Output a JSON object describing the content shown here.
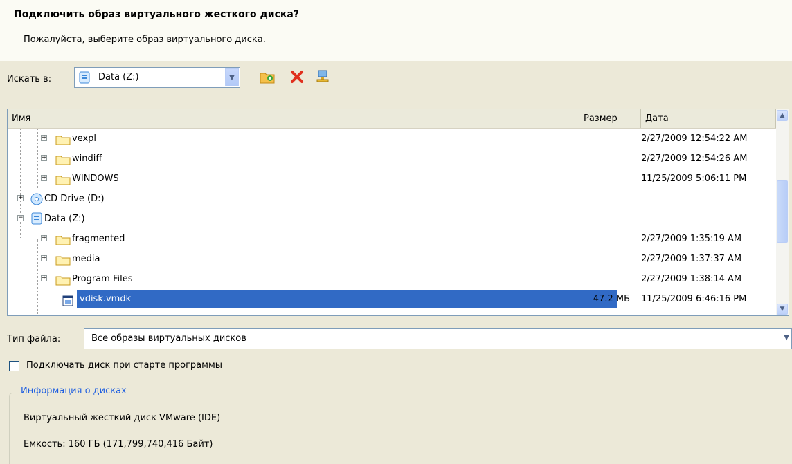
{
  "dialog": {
    "title": "Подключить образ виртуального жесткого диска?",
    "subtitle": "Пожалуйста, выберите образ виртуального диска."
  },
  "lookin": {
    "label": "Искать в:",
    "value": "Data (Z:)"
  },
  "toolbar": {
    "icons": [
      "new-folder-icon",
      "delete-icon",
      "network-icon"
    ]
  },
  "list": {
    "headers": {
      "name": "Имя",
      "size": "Размер",
      "date": "Дата"
    },
    "rows": [
      {
        "name": "vexpl",
        "size": "",
        "date": "2/27/2009 12:54:22 AM",
        "icon": "folder-icon",
        "expander": "+",
        "level": 1
      },
      {
        "name": "windiff",
        "size": "",
        "date": "2/27/2009 12:54:26 AM",
        "icon": "folder-icon",
        "expander": "+",
        "level": 1
      },
      {
        "name": "WINDOWS",
        "size": "",
        "date": "11/25/2009 5:06:11 PM",
        "icon": "folder-icon",
        "expander": "+",
        "level": 1
      },
      {
        "name": "CD Drive (D:)",
        "size": "",
        "date": "",
        "icon": "cd-drive-icon",
        "expander": "+",
        "level": 0
      },
      {
        "name": "Data (Z:)",
        "size": "",
        "date": "",
        "icon": "drive-icon",
        "expander": "−",
        "level": 0
      },
      {
        "name": "fragmented",
        "size": "",
        "date": "2/27/2009 1:35:19 AM",
        "icon": "folder-icon",
        "expander": "+",
        "level": 1
      },
      {
        "name": "media",
        "size": "",
        "date": "2/27/2009 1:37:37 AM",
        "icon": "folder-icon",
        "expander": "+",
        "level": 1
      },
      {
        "name": "Program Files",
        "size": "",
        "date": "2/27/2009 1:38:14 AM",
        "icon": "folder-icon",
        "expander": "+",
        "level": 1
      },
      {
        "name": "vdisk.vmdk",
        "size": "47.2 МБ",
        "date": "11/25/2009 6:46:16 PM",
        "icon": "vmdk-file-icon",
        "expander": "",
        "level": 1,
        "selected": true
      }
    ]
  },
  "filetype": {
    "label": "Тип файла:",
    "value": "Все образы виртуальных дисков"
  },
  "mount_on_start": {
    "label": "Подключать диск при старте программы",
    "checked": false
  },
  "disk_info": {
    "legend": "Информация о дисках",
    "type": "Виртуальный жесткий диск VMware (IDE)",
    "capacity": "Емкость:  160 ГБ (171,799,740,416 Байт)"
  },
  "colors": {
    "selection": "#316ac5",
    "legend": "#1e5ee0",
    "background": "#ece9d8"
  }
}
